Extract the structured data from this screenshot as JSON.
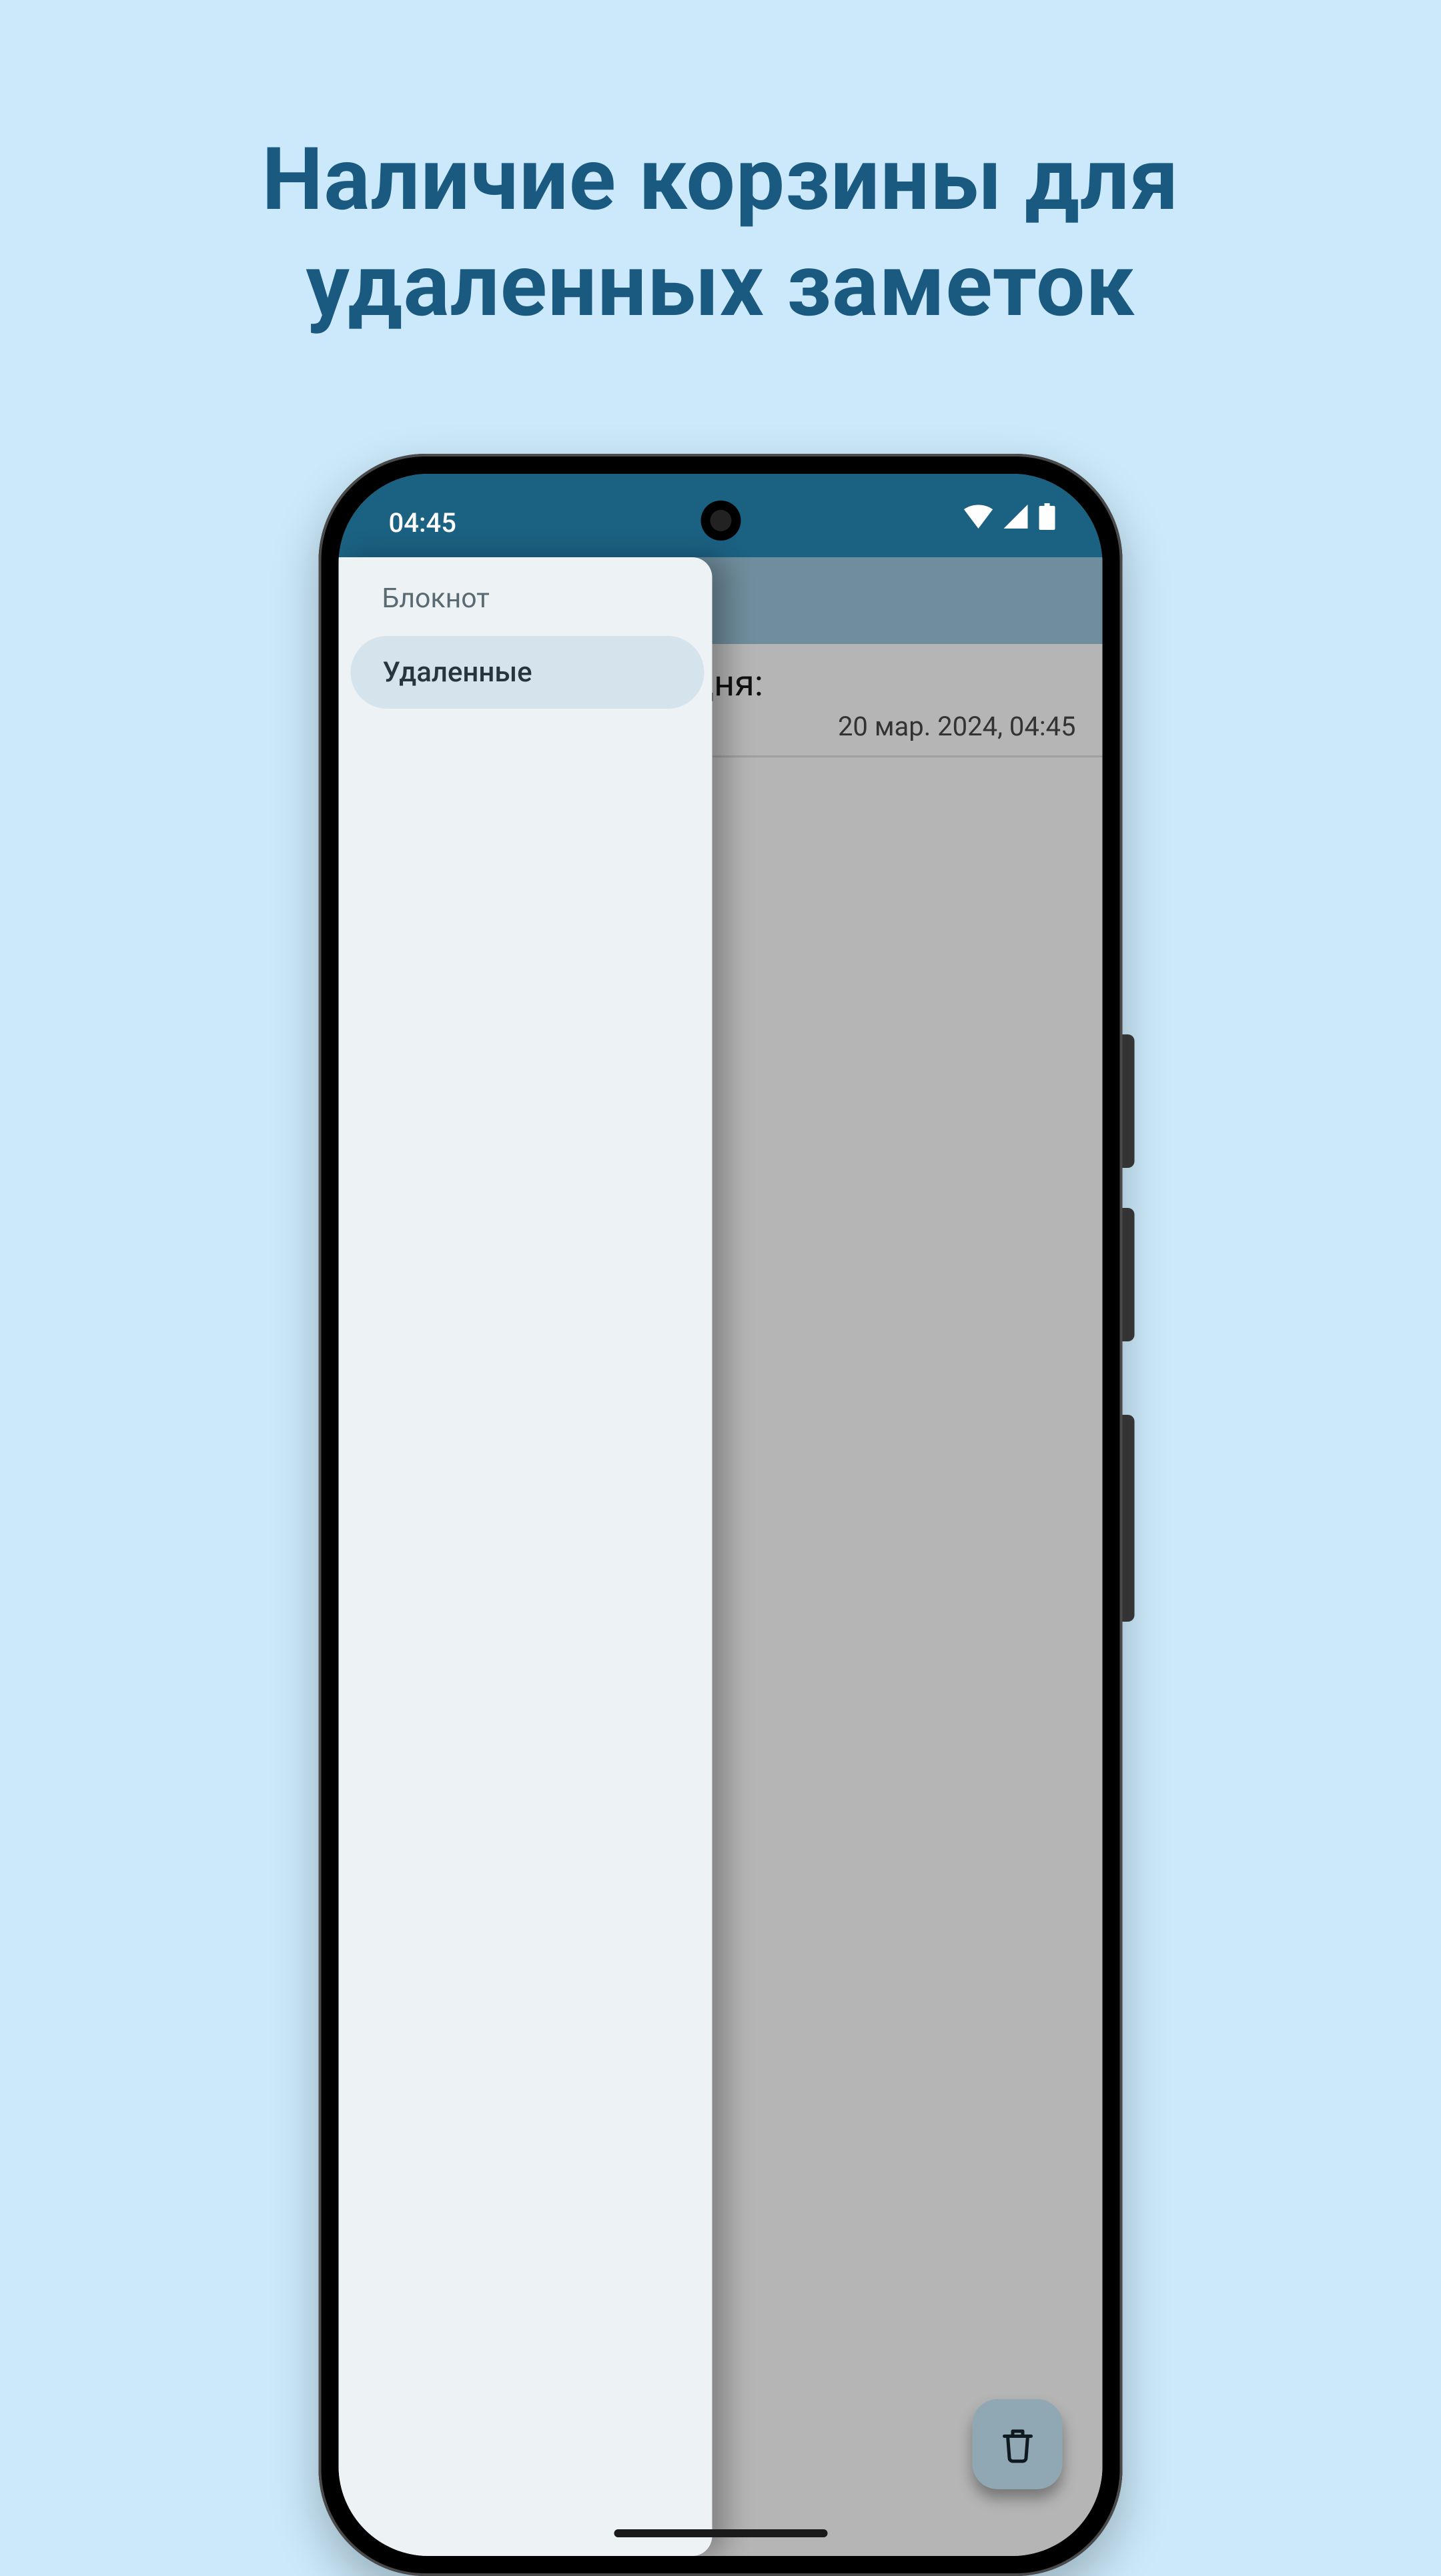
{
  "headline": "Наличие корзины для удаленных заметок",
  "status": {
    "time": "04:45"
  },
  "drawer": {
    "items": [
      {
        "label": "Блокнот",
        "selected": false
      },
      {
        "label": "Удаленные",
        "selected": true
      }
    ]
  },
  "note": {
    "title_fragment": "дня:",
    "date": "20 мар. 2024, 04:45"
  },
  "fab": {
    "icon": "trash-icon"
  }
}
